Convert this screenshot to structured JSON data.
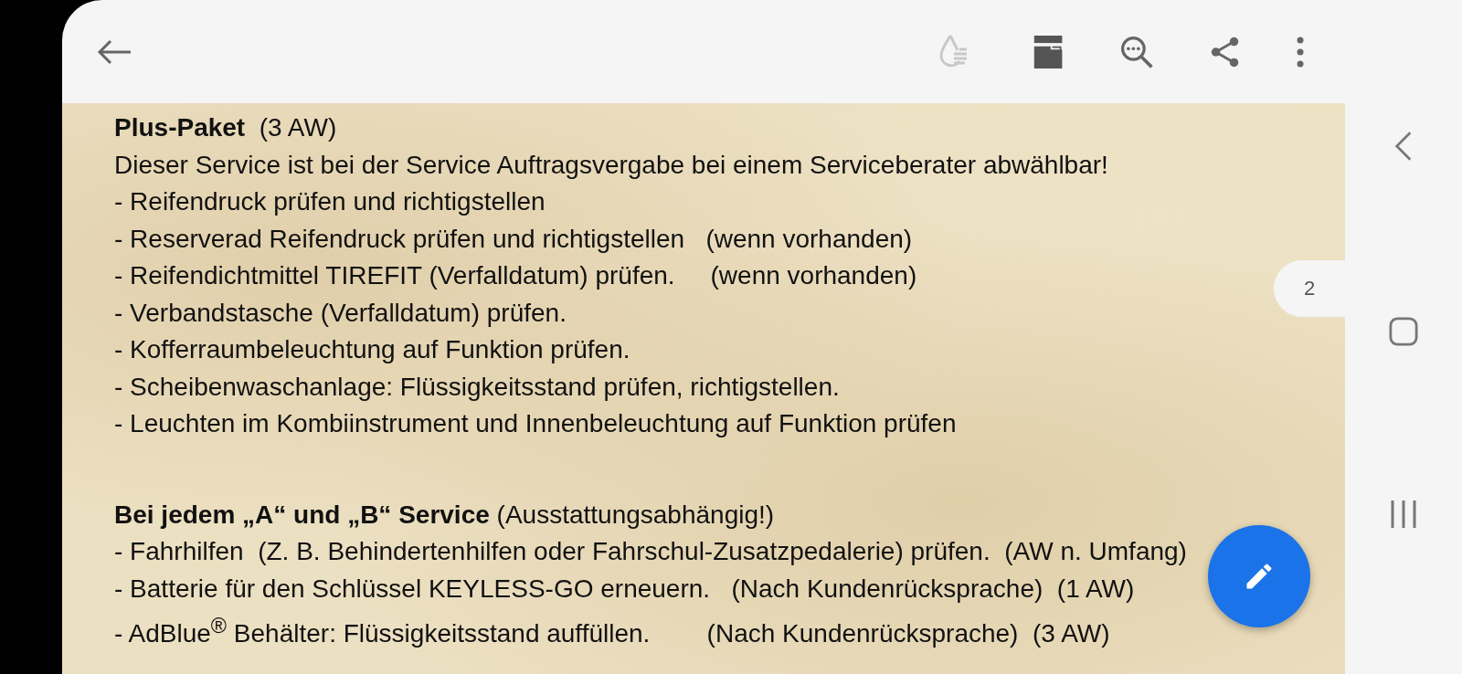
{
  "page_indicator": "2",
  "document": {
    "sections": [
      {
        "heading": "**Plus-Paket**  (3 AW)",
        "lines": [
          "Dieser Service ist bei der Service Auftragsvergabe bei einem Serviceberater abwählbar!",
          "- Reifendruck prüfen und richtigstellen",
          "- Reserverad Reifendruck prüfen und richtigstellen   (wenn vorhanden)",
          "- Reifendichtmittel TIREFIT (Verfalldatum) prüfen.     (wenn vorhanden)",
          "- Verbandstasche (Verfalldatum) prüfen.",
          "- Kofferraumbeleuchtung auf Funktion prüfen.",
          "- Scheibenwaschanlage: Flüssigkeitsstand prüfen, richtigstellen.",
          "- Leuchten im Kombiinstrument und Innenbeleuchtung auf Funktion prüfen"
        ]
      },
      {
        "heading": "**Bei jedem „A“ und „B“ Service** (Ausstattungsabhängig!)",
        "lines": [
          "- Fahrhilfen  (Z. B. Behindertenhilfen oder Fahrschul-Zusatzpedalerie) prüfen.  (AW n. Umfang)",
          "- Batterie für den Schlüssel KEYLESS-GO erneuern.   (Nach Kundenrücksprache)  (1 AW)",
          "- AdBlue$^{®}$ Behälter: Flüssigkeitsstand auffüllen.        (Nach Kundenrücksprache)  (3 AW)"
        ]
      }
    ]
  }
}
